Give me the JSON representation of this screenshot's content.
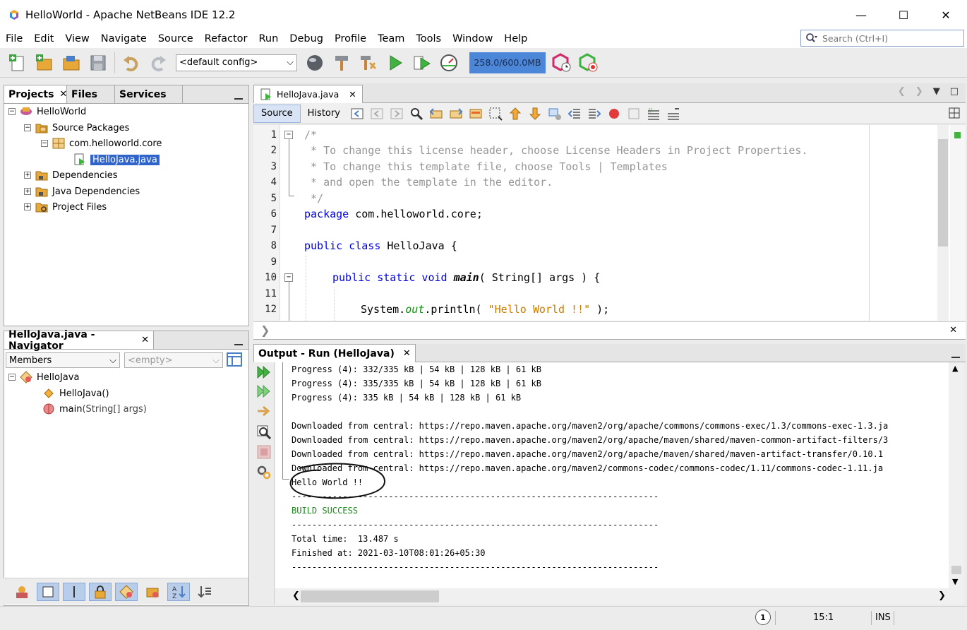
{
  "window": {
    "title": "HelloWorld - Apache NetBeans IDE 12.2",
    "minimize": "—",
    "maximize": "☐",
    "close": "✕"
  },
  "menu": [
    "File",
    "Edit",
    "View",
    "Navigate",
    "Source",
    "Refactor",
    "Run",
    "Debug",
    "Profile",
    "Team",
    "Tools",
    "Window",
    "Help"
  ],
  "search": {
    "placeholder": "Search (Ctrl+I)"
  },
  "toolbar": {
    "config": "<default config>",
    "memory": "258.0/600.0MB"
  },
  "projects_panel": {
    "tabs": [
      "Projects",
      "Files",
      "Services"
    ],
    "tree": {
      "root": "HelloWorld",
      "source_packages": "Source Packages",
      "package": "com.helloworld.core",
      "file": "HelloJava.java",
      "dependencies": "Dependencies",
      "java_dependencies": "Java Dependencies",
      "project_files": "Project Files"
    }
  },
  "navigator": {
    "title": "HelloJava.java - Navigator",
    "filter": "Members",
    "empty": "<empty>",
    "class": "HelloJava",
    "constructor": "HelloJava()",
    "method_name": "main",
    "method_params": "(String[] args)"
  },
  "editor": {
    "tab": "HelloJava.java",
    "source_label": "Source",
    "history_label": "History",
    "line_numbers": [
      "1",
      "2",
      "3",
      "4",
      "5",
      "6",
      "7",
      "8",
      "9",
      "10",
      "11",
      "12"
    ],
    "code": {
      "l1": "/*",
      "l2": " * To change this license header, choose License Headers in Project Properties.",
      "l3": " * To change this template file, choose Tools | Templates",
      "l4": " * and open the template in the editor.",
      "l5": " */",
      "l6_kw": "package",
      "l6_rest": " com.helloworld.core;",
      "l8_kw": "public class",
      "l8_rest": " HelloJava {",
      "l10_kw": "public static void",
      "l10_name": "main",
      "l10_rest": "( String[] args ) {",
      "l12_a": "System.",
      "l12_field": "out",
      "l12_b": ".println( ",
      "l12_str": "\"Hello World !!\"",
      "l12_c": " );"
    }
  },
  "output": {
    "tab": "Output - Run (HelloJava)",
    "lines": [
      "Progress (4): 332/335 kB | 54 kB | 128 kB | 61 kB",
      "Progress (4): 335/335 kB | 54 kB | 128 kB | 61 kB",
      "Progress (4): 335 kB | 54 kB | 128 kB | 61 kB",
      "",
      "Downloaded from central: https://repo.maven.apache.org/maven2/org/apache/commons/commons-exec/1.3/commons-exec-1.3.ja",
      "Downloaded from central: https://repo.maven.apache.org/maven2/org/apache/maven/shared/maven-common-artifact-filters/3",
      "Downloaded from central: https://repo.maven.apache.org/maven2/org/apache/maven/shared/maven-artifact-transfer/0.10.1",
      "Downloaded from central: https://repo.maven.apache.org/maven2/commons-codec/commons-codec/1.11/commons-codec-1.11.ja",
      "Hello World !!",
      "------------------------------------------------------------------------",
      "BUILD SUCCESS",
      "------------------------------------------------------------------------",
      "Total time:  13.487 s",
      "Finished at: 2021-03-10T08:01:26+05:30",
      "------------------------------------------------------------------------"
    ]
  },
  "status": {
    "notifications": "1",
    "position": "15:1",
    "mode": "INS"
  },
  "colors": {
    "selection": "#2f65ca",
    "keyword": "#0000e6",
    "string": "#ce7b00",
    "comment": "#969696",
    "build_success": "#1a8a1a",
    "memory_bar": "#4b86d8"
  }
}
